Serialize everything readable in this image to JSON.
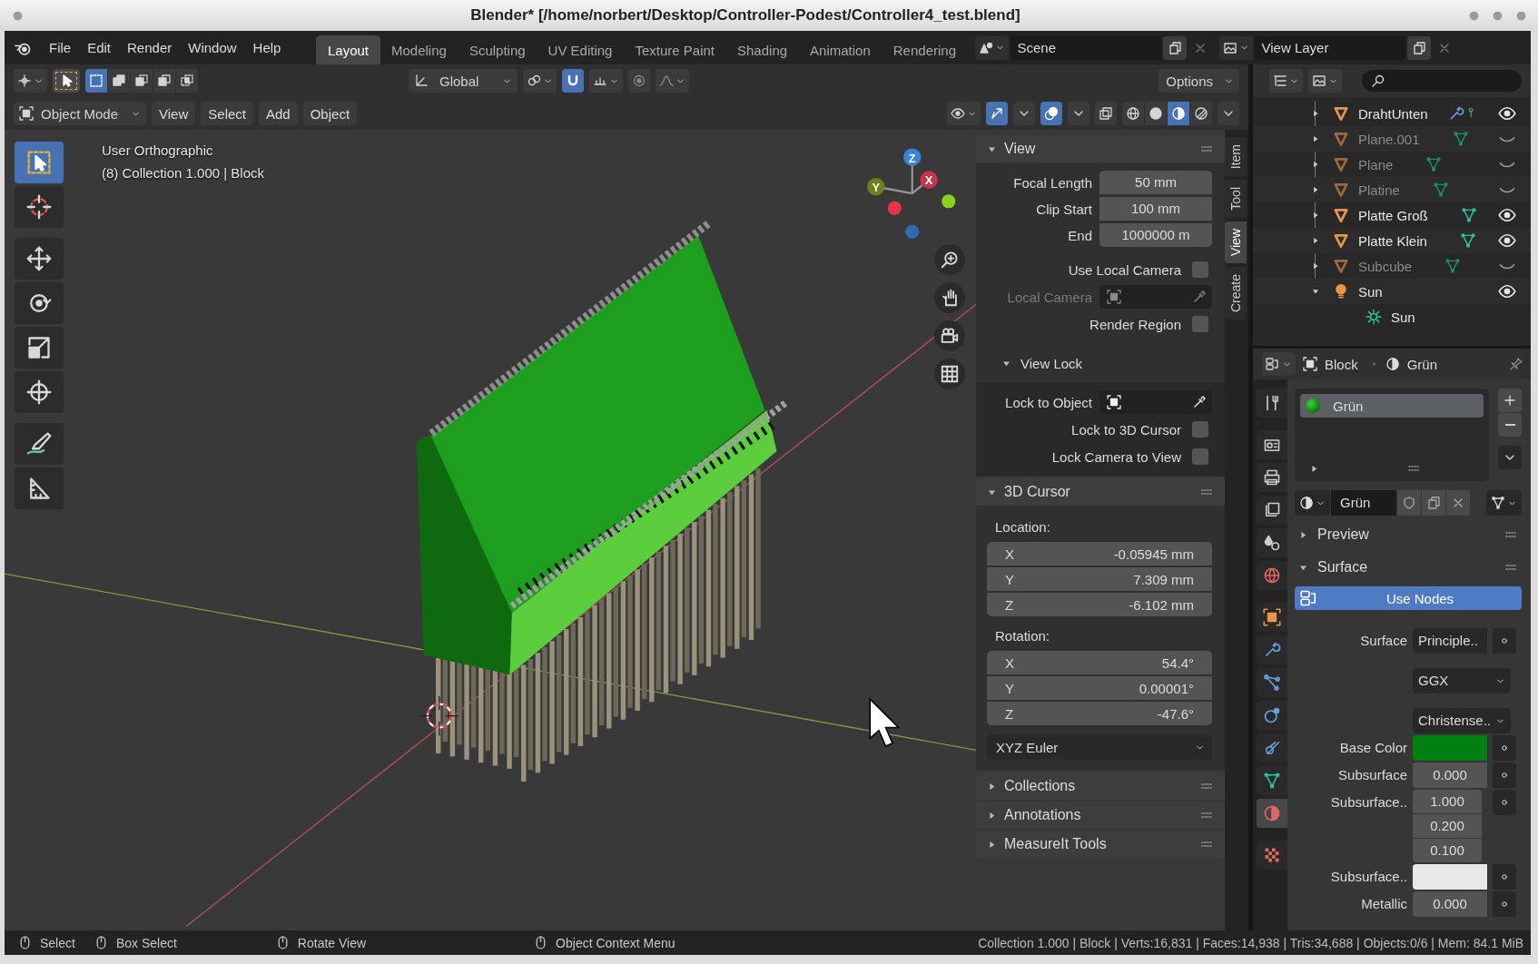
{
  "window": {
    "title": "Blender* [/home/norbert/Desktop/Controller-Podest/Controller4_test.blend]"
  },
  "menu": [
    "File",
    "Edit",
    "Render",
    "Window",
    "Help"
  ],
  "workspaces": [
    {
      "label": "Layout",
      "selected": true
    },
    {
      "label": "Modeling",
      "selected": false
    },
    {
      "label": "Sculpting",
      "selected": false
    },
    {
      "label": "UV Editing",
      "selected": false
    },
    {
      "label": "Texture Paint",
      "selected": false
    },
    {
      "label": "Shading",
      "selected": false
    },
    {
      "label": "Animation",
      "selected": false
    },
    {
      "label": "Rendering",
      "selected": false
    }
  ],
  "scene": "Scene",
  "view_layer": "View Layer",
  "tool_header": {
    "select_modes": [
      {
        "selected": true
      },
      {
        "selected": false
      },
      {
        "selected": false
      },
      {
        "selected": false
      },
      {
        "selected": false
      }
    ],
    "orientation": "Global",
    "snap_on": true,
    "options": "Options"
  },
  "viewport_header": {
    "mode": "Object Mode",
    "menu": [
      "View",
      "Select",
      "Add",
      "Object"
    ],
    "gizmos_on": true,
    "overlays_on": true,
    "xray_on": false,
    "shading": [
      {
        "selected": false
      },
      {
        "selected": false
      },
      {
        "selected": true
      },
      {
        "selected": false
      }
    ]
  },
  "viewport": {
    "view_name": "User Orthographic",
    "info": "(8) Collection 1.000 | Block",
    "gizmo_axes": [
      "Z",
      "Y",
      "X"
    ]
  },
  "toolbar": [
    {
      "selected": true
    },
    {
      "selected": false
    },
    {
      "selected": false
    },
    {
      "selected": false
    },
    {
      "selected": false
    },
    {
      "selected": false
    },
    {
      "selected": false
    },
    {
      "selected": false
    }
  ],
  "sidebar": {
    "tabs": [
      {
        "label": "Item",
        "selected": false
      },
      {
        "label": "Tool",
        "selected": false
      },
      {
        "label": "View",
        "selected": true
      },
      {
        "label": "Create",
        "selected": false
      }
    ],
    "panels": [
      {
        "kind": "view",
        "title": "View",
        "expanded": true,
        "fields": [
          {
            "label": "Focal Length",
            "value": "50 mm"
          },
          {
            "label": "Clip Start",
            "value": "100 mm"
          },
          {
            "label": "End",
            "value": "1000000 m"
          }
        ],
        "rows": [
          {
            "kind": "check",
            "label": "Use Local Camera",
            "checked": false
          },
          {
            "kind": "picker",
            "label": "Local Camera",
            "disabled": true
          },
          {
            "kind": "check",
            "label": "Render Region",
            "checked": false
          }
        ],
        "lock": {
          "title": "View Lock",
          "expanded": true,
          "rows": [
            {
              "kind": "picker",
              "label": "Lock to Object",
              "disabled": false
            },
            {
              "kind": "check",
              "label": "Lock to 3D Cursor",
              "checked": false
            },
            {
              "kind": "check",
              "label": "Lock Camera to View",
              "checked": false
            }
          ]
        }
      },
      {
        "kind": "cursor",
        "title": "3D Cursor",
        "expanded": true,
        "location_label": "Location:",
        "location": [
          {
            "axis": "X",
            "value": "-0.05945 mm"
          },
          {
            "axis": "Y",
            "value": "7.309 mm"
          },
          {
            "axis": "Z",
            "value": "-6.102 mm"
          }
        ],
        "rotation_label": "Rotation:",
        "rotation": [
          {
            "axis": "X",
            "value": "54.4°"
          },
          {
            "axis": "Y",
            "value": "0.00001°"
          },
          {
            "axis": "Z",
            "value": "-47.6°"
          }
        ],
        "rotation_mode": "XYZ Euler"
      },
      {
        "title": "Collections",
        "expanded": false
      },
      {
        "title": "Annotations",
        "expanded": false
      },
      {
        "title": "MeasureIt Tools",
        "expanded": false
      }
    ]
  },
  "outliner": {
    "items": [
      {
        "name": "DrahtUnten",
        "kind": "mesh",
        "visible": true,
        "modifier": true,
        "expanded": false
      },
      {
        "name": "Plane.001",
        "kind": "mesh",
        "visible": false,
        "modifier": false,
        "expanded": false
      },
      {
        "name": "Plane",
        "kind": "mesh",
        "visible": false,
        "modifier": false,
        "expanded": false
      },
      {
        "name": "Platine",
        "kind": "mesh",
        "visible": false,
        "modifier": false,
        "expanded": false
      },
      {
        "name": "Platte Groß",
        "kind": "mesh",
        "visible": true,
        "modifier": false,
        "expanded": false
      },
      {
        "name": "Platte Klein",
        "kind": "mesh",
        "visible": true,
        "modifier": false,
        "expanded": false
      },
      {
        "name": "Subcube",
        "kind": "mesh",
        "visible": false,
        "modifier": false,
        "expanded": false
      },
      {
        "name": "Sun",
        "kind": "light",
        "visible": true,
        "modifier": false,
        "expanded": true,
        "children": [
          {
            "name": "Sun"
          }
        ]
      }
    ]
  },
  "properties": {
    "object": "Block",
    "material": "Grün",
    "tabs": [
      {
        "selected": false
      },
      {
        "selected": false
      },
      {
        "selected": false
      },
      {
        "selected": false
      },
      {
        "selected": false
      },
      {
        "selected": false
      },
      {
        "selected": false
      },
      {
        "selected": false
      },
      {
        "selected": false
      },
      {
        "selected": false
      },
      {
        "selected": false
      },
      {
        "selected": false
      },
      {
        "selected": true
      },
      {
        "selected": false
      }
    ],
    "slots": [
      {
        "name": "Grün",
        "selected": true
      }
    ],
    "datablock": "Grün",
    "panels": [
      {
        "title": "Preview",
        "expanded": false
      },
      {
        "title": "Surface",
        "expanded": true,
        "use_nodes": "Use Nodes",
        "rows": [
          {
            "kind": "link",
            "label": "Surface",
            "value": "Principle.."
          },
          {
            "kind": "dropdown",
            "value": "GGX"
          },
          {
            "kind": "dropdown",
            "value": "Christense.."
          },
          {
            "kind": "color",
            "label": "Base Color",
            "color": "#007f12"
          },
          {
            "kind": "number",
            "label": "Subsurface",
            "value": "0.000"
          },
          {
            "kind": "vector",
            "label": "Subsurface..",
            "values": [
              "1.000",
              "0.200",
              "0.100"
            ]
          },
          {
            "kind": "color",
            "label": "Subsurface..",
            "color": "#e8e8e8"
          },
          {
            "kind": "number",
            "label": "Metallic",
            "value": "0.000"
          }
        ]
      }
    ]
  },
  "status_bar": {
    "hints": [
      "Select",
      "Box Select",
      "Rotate View",
      "Object Context Menu"
    ],
    "stats": "Collection 1.000 | Block | Verts:16,831 | Faces:14,938 | Tris:34,688 | Objects:0/6 | Mem: 84.1 MiB"
  }
}
